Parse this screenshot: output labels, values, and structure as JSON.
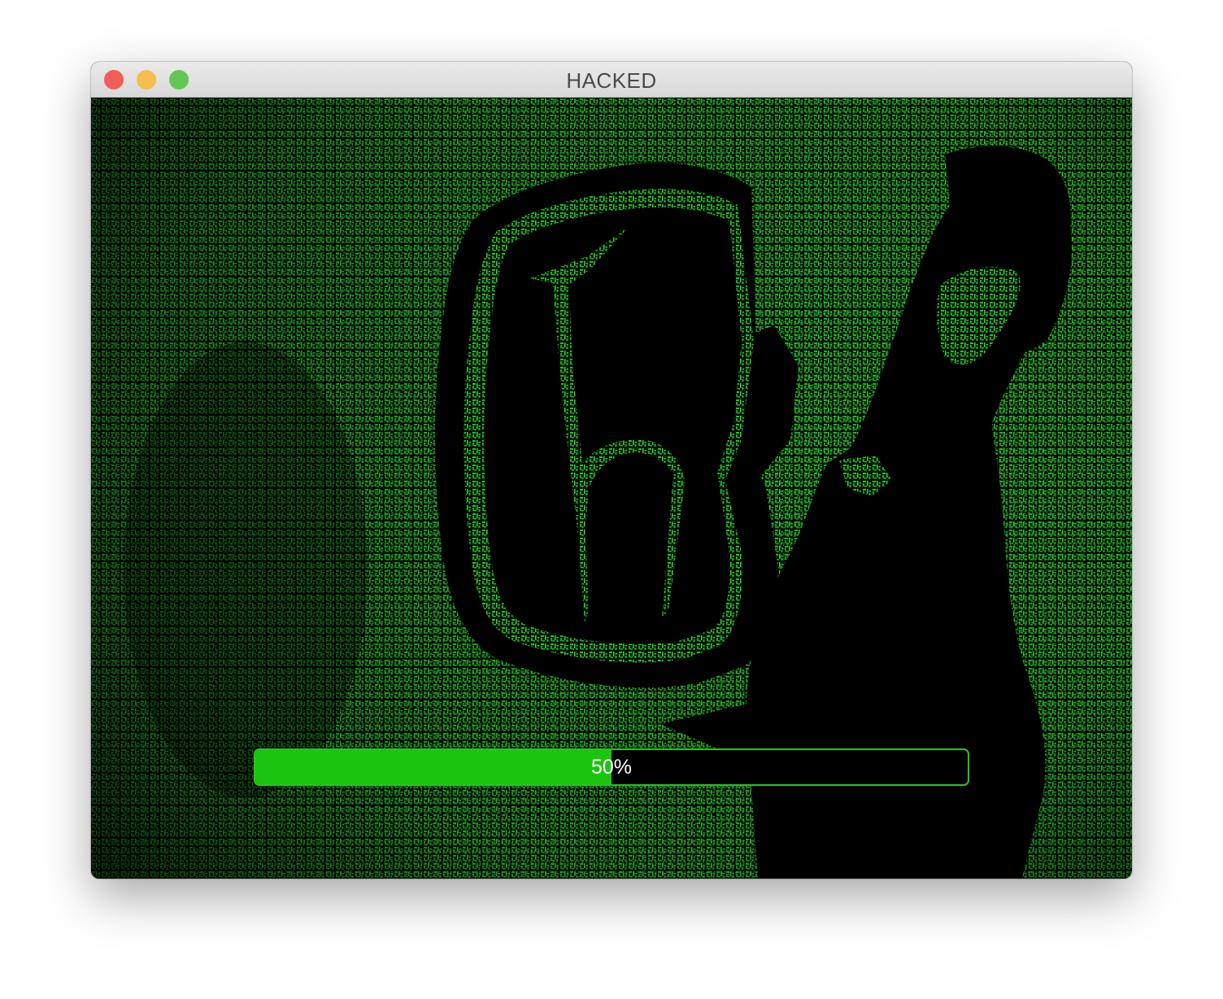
{
  "window": {
    "title": "HACKED",
    "traffic_lights": {
      "close_color": "#ee5f56",
      "minimize_color": "#f6be4f",
      "zoom_color": "#62c655"
    }
  },
  "background": {
    "description_icon": "matrix-code-hacker-silhouette",
    "code_color": "#25d62a",
    "silhouette_color": "#000000"
  },
  "progress": {
    "value": 50,
    "label": "50%",
    "fill_color": "#1bc40f",
    "border_color": "#2cc02c"
  }
}
